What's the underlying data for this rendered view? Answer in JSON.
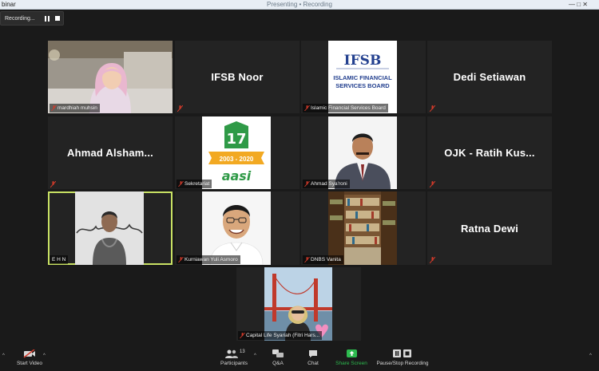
{
  "titlebar": {
    "left": "binar",
    "center": "Presenting • Recording",
    "controls": "— □ ✕"
  },
  "recording": {
    "label": "Recording..."
  },
  "tiles": [
    {
      "kind": "video",
      "caption": "mardhiah muhsin"
    },
    {
      "kind": "name",
      "display_name": "IFSB Noor"
    },
    {
      "kind": "video",
      "caption": "Islamic Financial Services Board",
      "logo_text_1": "IFSB",
      "logo_text_2": "ISLAMIC FINANCIAL",
      "logo_text_3": "SERVICES BOARD"
    },
    {
      "kind": "name",
      "display_name": "Dedi Setiawan"
    },
    {
      "kind": "name",
      "display_name": "Ahmad Alsham..."
    },
    {
      "kind": "video",
      "caption": "Sekretariat",
      "logo_num": "17",
      "logo_years": "2003 - 2020",
      "logo_word": "aasi"
    },
    {
      "kind": "video",
      "caption": "Ahmad Sya'roni"
    },
    {
      "kind": "name",
      "display_name": "OJK - Ratih Kus..."
    },
    {
      "kind": "video",
      "caption": "E H N"
    },
    {
      "kind": "video",
      "caption": "Kurniawan Yuli Asmoro"
    },
    {
      "kind": "video",
      "caption": "DNBS Vanita"
    },
    {
      "kind": "name",
      "display_name": "Ratna Dewi"
    },
    {
      "kind": "video",
      "caption": "Capital Life Syariah (Fitri Hars..."
    }
  ],
  "toolbar": {
    "start_video": "Start Video",
    "participants": "Participants",
    "participants_count": "13",
    "qa": "Q&A",
    "chat": "Chat",
    "share_screen": "Share Screen",
    "pause_stop": "Pause/Stop Recording"
  },
  "colors": {
    "background": "#1a1a1a",
    "tile": "#232323",
    "active_speaker": "#c9e264",
    "share_green": "#2dbb4f",
    "mute_red": "#d23a2a"
  }
}
